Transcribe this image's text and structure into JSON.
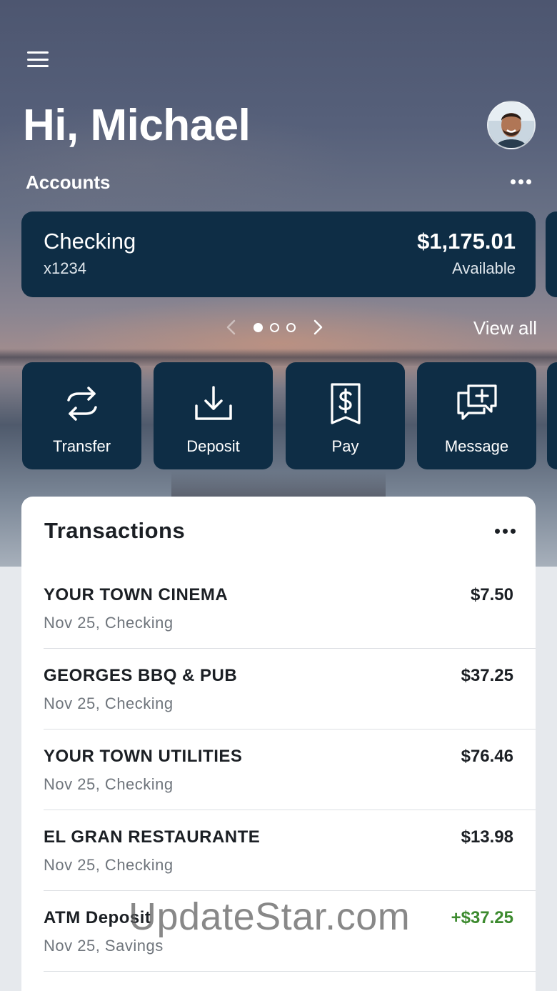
{
  "header": {
    "greeting": "Hi, Michael",
    "menu_icon": "hamburger-menu-icon"
  },
  "accounts": {
    "section_label": "Accounts",
    "more_icon": "more-horizontal-icon",
    "card": {
      "name": "Checking",
      "number": "x1234",
      "balance": "$1,175.01",
      "balance_label": "Available"
    },
    "pager": {
      "pages": 3,
      "current": 1
    },
    "view_all_label": "View all"
  },
  "quick_actions": [
    {
      "label": "Transfer",
      "icon": "transfer-arrows-icon"
    },
    {
      "label": "Deposit",
      "icon": "download-tray-icon"
    },
    {
      "label": "Pay",
      "icon": "dollar-receipt-icon"
    },
    {
      "label": "Message",
      "icon": "chat-plus-icon"
    }
  ],
  "transactions": {
    "title": "Transactions",
    "items": [
      {
        "merchant": "YOUR TOWN CINEMA",
        "meta": "Nov 25, Checking",
        "amount": "$7.50",
        "credit": false
      },
      {
        "merchant": "GEORGES BBQ & PUB",
        "meta": "Nov 25, Checking",
        "amount": "$37.25",
        "credit": false
      },
      {
        "merchant": "YOUR TOWN UTILITIES",
        "meta": "Nov 25, Checking",
        "amount": "$76.46",
        "credit": false
      },
      {
        "merchant": "EL GRAN RESTAURANTE",
        "meta": "Nov 25, Checking",
        "amount": "$13.98",
        "credit": false
      },
      {
        "merchant": "ATM Deposit",
        "meta": "Nov 25, Savings",
        "amount": "+$37.25",
        "credit": true
      }
    ]
  },
  "watermark": "UpdateStar.com",
  "colors": {
    "card_navy": "#0e2d45",
    "credit_green": "#3c8a2e",
    "text_dark": "#1b1f24",
    "text_muted": "#6f757c"
  }
}
